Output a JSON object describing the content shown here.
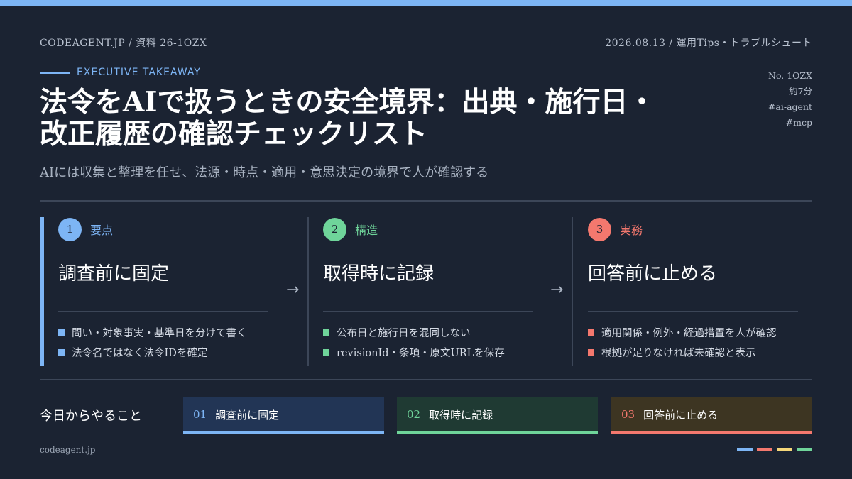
{
  "header": {
    "site": "CODEAGENT.JP",
    "sep": " / ",
    "doc_id": "資料 26-1OZX",
    "date": "2026.08.13",
    "category": "運用Tips・トラブルシュート"
  },
  "eyebrow": "EXECUTIVE TAKEAWAY",
  "side_meta": {
    "number": "No. 1OZX",
    "read_time": "約7分",
    "tags": [
      "#ai-agent",
      "#mcp"
    ]
  },
  "title_lines": [
    "法令をAIで扱うときの安全境界：出典・施行日・",
    "改正履歴の確認チェックリスト"
  ],
  "subtitle": "AIには収集と整理を任せ、法源・時点・適用・意思決定の境界で人が確認する",
  "columns": [
    {
      "num": "1",
      "label": "要点",
      "heading": "調査前に固定",
      "bullets": [
        "問い・対象事実・基準日を分けて書く",
        "法令名ではなく法令IDを確定"
      ]
    },
    {
      "num": "2",
      "label": "構造",
      "heading": "取得時に記録",
      "bullets": [
        "公布日と施行日を混同しない",
        "revisionId・条項・原文URLを保存"
      ]
    },
    {
      "num": "3",
      "label": "実務",
      "heading": "回答前に止める",
      "bullets": [
        "適用関係・例外・経過措置を人が確認",
        "根拠が足りなければ未確認と表示"
      ]
    }
  ],
  "arrow": "→",
  "today": {
    "label": "今日からやること",
    "steps": [
      {
        "num": "01",
        "text": "調査前に固定"
      },
      {
        "num": "02",
        "text": "取得時に記録"
      },
      {
        "num": "03",
        "text": "回答前に止める"
      }
    ]
  },
  "footer": "codeagent.jp",
  "colors": {
    "background": "#1b2332",
    "blue": "#7db5f5",
    "green": "#6fd49a",
    "coral": "#f4786e",
    "yellow": "#f5d77a",
    "footer_dashes": [
      "#7db5f5",
      "#f4786e",
      "#f5d77a",
      "#6fd49a"
    ]
  }
}
